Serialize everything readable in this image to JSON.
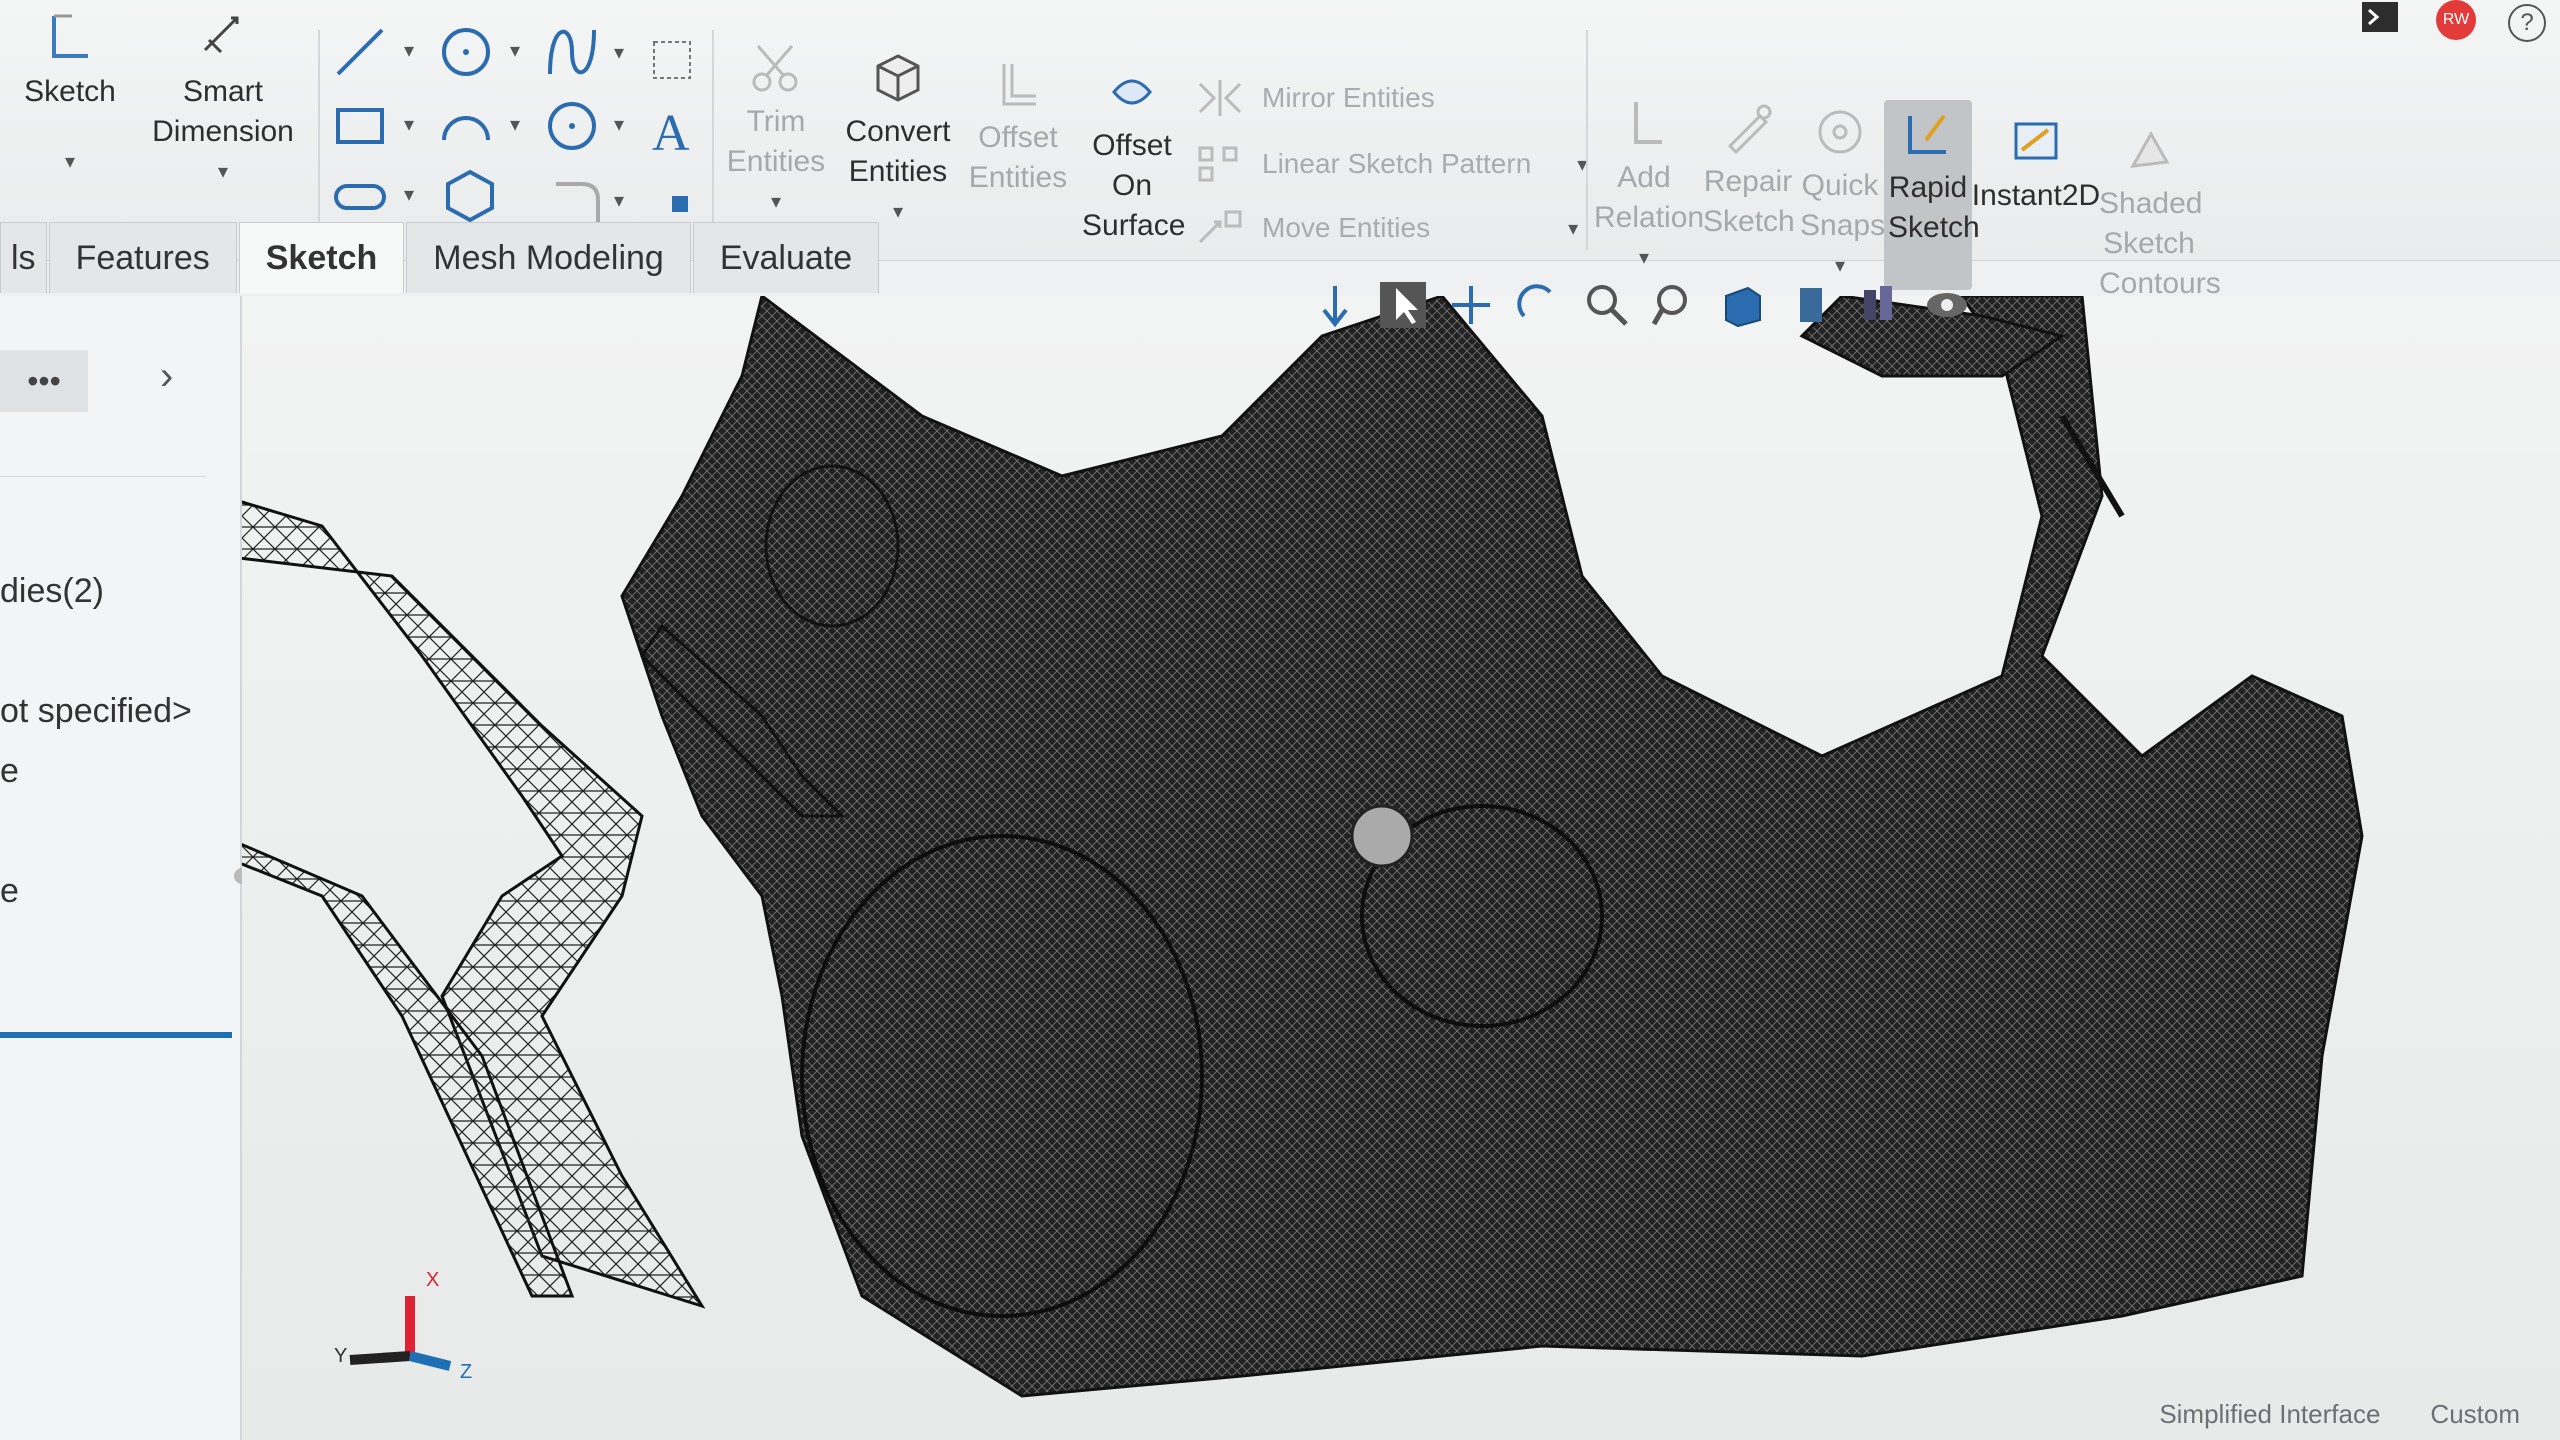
{
  "ribbon": {
    "sketch_label": "Sketch",
    "smart_dimension_label": "Smart Dimension",
    "trim_label": "Trim Entities",
    "convert_label": "Convert Entities",
    "offset_label": "Offset Entities",
    "offset_surface_label": "Offset On Surface",
    "mirror_label": "Mirror Entities",
    "linear_pattern_label": "Linear Sketch Pattern",
    "move_label": "Move Entities",
    "add_relation_label": "Add Relation",
    "repair_label": "Repair Sketch",
    "quick_snaps_label": "Quick Snaps",
    "rapid_sketch_label": "Rapid Sketch",
    "instant2d_label": "Instant2D",
    "shaded_label": "Shaded Sketch Contours"
  },
  "tabs": [
    {
      "label": "ls"
    },
    {
      "label": "Features"
    },
    {
      "label": "Sketch"
    },
    {
      "label": "Mesh Modeling"
    },
    {
      "label": "Evaluate"
    }
  ],
  "panel": {
    "more_label": "•••",
    "bodies_label": "dies(2)",
    "material_label": "ot specified>",
    "item_e1": "e",
    "item_e2": "e"
  },
  "triad": {
    "x_label": "X",
    "y_label": "Y",
    "z_label": "Z"
  },
  "status": {
    "simplified_label": "Simplified Interface",
    "custom_label": "Custom"
  },
  "user": {
    "initials": "RW"
  },
  "colors": {
    "accent": "#1f6fb5",
    "mesh": "#1c1c1c",
    "active_button": "#b7babc"
  }
}
